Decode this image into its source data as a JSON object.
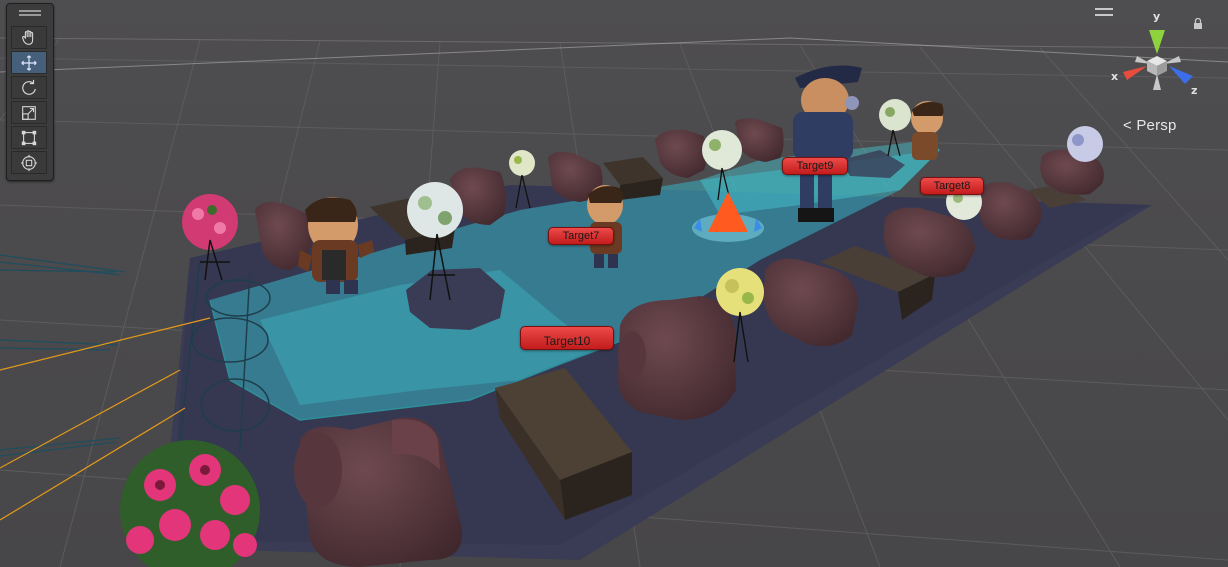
{
  "scene_view": {
    "camera_mode": "< Persp",
    "gizmo": {
      "axes": {
        "x": "x",
        "y": "y",
        "z": "z"
      },
      "colors": {
        "x": "#e74c3c",
        "y": "#8cd33d",
        "z": "#3b6ee8"
      }
    }
  },
  "tools_overlay": {
    "tools": [
      {
        "name": "hand-tool",
        "icon": "hand-icon",
        "active": false
      },
      {
        "name": "move-tool",
        "icon": "move-icon",
        "active": true
      },
      {
        "name": "rotate-tool",
        "icon": "rotate-icon",
        "active": false
      },
      {
        "name": "scale-tool",
        "icon": "scale-icon",
        "active": false
      },
      {
        "name": "rect-tool",
        "icon": "rect-icon",
        "active": false
      },
      {
        "name": "transform-tool",
        "icon": "transform-icon",
        "active": false
      }
    ]
  },
  "targets": {
    "target7": "Target7",
    "target9": "Target9",
    "target8": "Target8",
    "target10": "Target10"
  },
  "colors": {
    "background": "#4b4a4c",
    "grid": "#5d5c5e",
    "floor": "#3b3d54",
    "navmesh": "#39b3c3",
    "tag": "#e03030"
  }
}
